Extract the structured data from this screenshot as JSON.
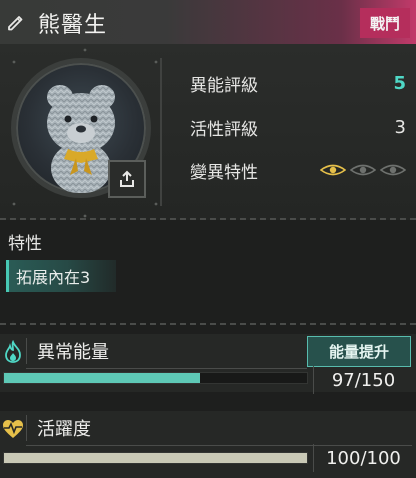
{
  "header": {
    "name": "熊醫生",
    "action_label": "戰鬥"
  },
  "stats": [
    {
      "label": "異能評級",
      "value": "5"
    },
    {
      "label": "活性評級",
      "value": "3"
    },
    {
      "label": "變異特性",
      "eyes_total": 3,
      "eyes_active": 1
    }
  ],
  "traits": {
    "title": "特性",
    "items": [
      "拓展內在3"
    ]
  },
  "energy": {
    "title": "異常能量",
    "button_label": "能量提升",
    "value_text": "97/150",
    "current": 97,
    "max": 150
  },
  "vitality": {
    "title": "活躍度",
    "value_text": "100/100",
    "current": 100,
    "max": 100
  },
  "colors": {
    "accent": "#4fd8c6",
    "battle": "#b52e5c",
    "energy_fill": "#5ec9b6",
    "vitality_fill": "#c9c9b6",
    "icon_gold": "#e6c04a"
  },
  "icons": {
    "edit": "pencil-icon",
    "share": "share-icon",
    "energy": "flame-icon",
    "vitality": "heart-pulse-icon",
    "trait": "eye-icon"
  }
}
